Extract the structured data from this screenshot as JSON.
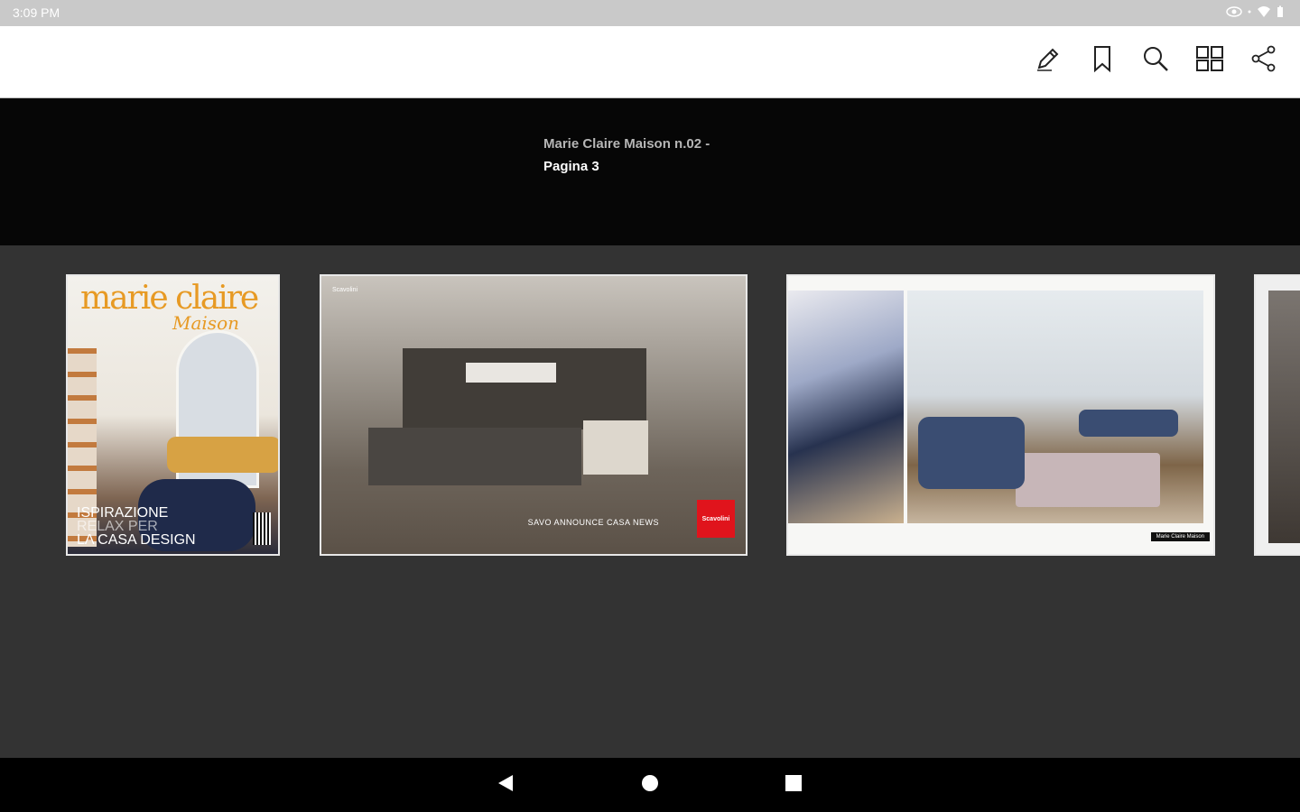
{
  "status_bar": {
    "time": "3:09 PM"
  },
  "toolbar": {
    "icons": [
      "pencil-icon",
      "bookmark-icon",
      "search-icon",
      "page-grid-icon",
      "share-icon"
    ]
  },
  "header": {
    "issue_title": "Marie Claire Maison n.02 -",
    "page_label": "Pagina 3"
  },
  "thumbnails": {
    "cover": {
      "masthead": "marie claire",
      "subtitle": "Maison",
      "headline_1": "ISPIRAZIONE",
      "headline_2": "RELAX PER",
      "headline_3": "LA CASA DESIGN"
    },
    "kitchen_ad": {
      "brand": "Scavolini",
      "tagline": "SAVO ANNOUNCE CASA NEWS"
    },
    "spread": {
      "caption": "Marie Claire Maison"
    }
  },
  "colors": {
    "accent_cover": "#e79a24",
    "toolbar_bg": "#ffffff",
    "info_bg": "#060606",
    "strip_bg": "#333333"
  }
}
